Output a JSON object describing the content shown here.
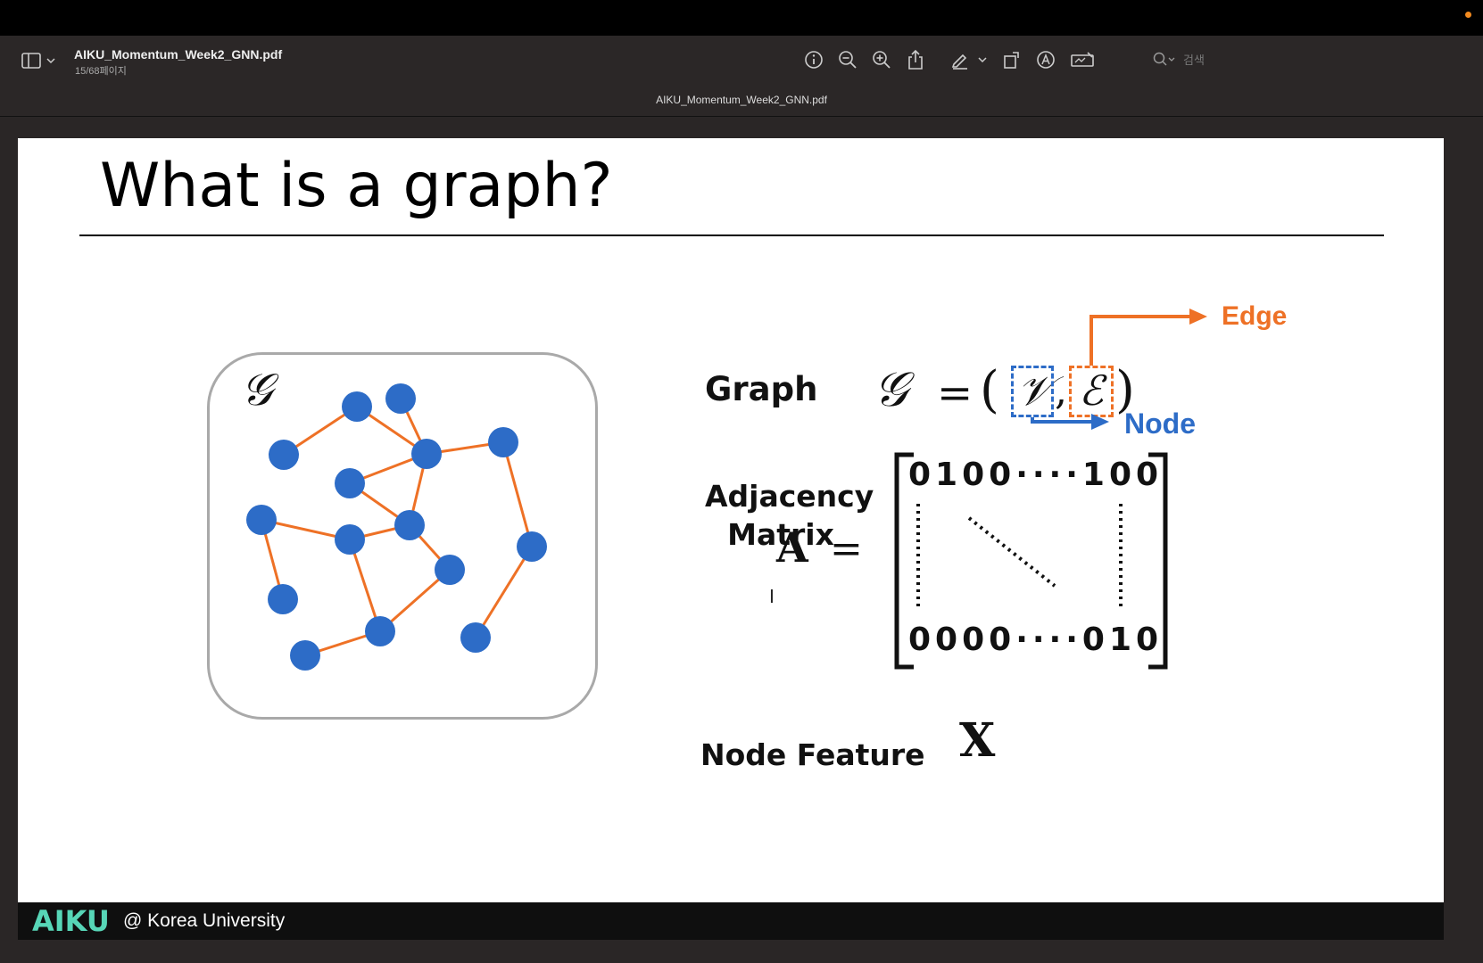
{
  "toolbar": {
    "doc_title": "AIKU_Momentum_Week2_GNN.pdf",
    "page_info": "15/68페이지",
    "tab_title": "AIKU_Momentum_Week2_GNN.pdf",
    "search_placeholder": "검색",
    "icons": [
      "info-icon",
      "zoom-out-icon",
      "zoom-in-icon",
      "share-icon",
      "highlight-icon",
      "chevron-down-icon",
      "rotate-icon",
      "markup-icon",
      "sign-icon"
    ]
  },
  "slide": {
    "title": "What is a graph?",
    "graph_symbol": "𝒢",
    "graph_label": "Graph",
    "eq_G": "𝒢",
    "eq_equals": "=",
    "eq_paren_left": "(",
    "eq_V": "𝒱",
    "eq_comma": ",",
    "eq_E": "ℰ",
    "eq_paren_right": ")",
    "edge_label": "Edge",
    "node_label": "Node",
    "adjacency_line1": "Adjacency",
    "adjacency_line2": "Matrix",
    "A_symbol": "A",
    "A_equals": "=",
    "matrix_row_first": "0100····100",
    "matrix_row_last": "0000····010",
    "node_feature_label": "Node Feature",
    "X_symbol": "X",
    "colors": {
      "node": "#2d6cc7",
      "edge": "#ee7126",
      "accent_logo": "#57d6b7"
    }
  },
  "footer": {
    "logo": "AIKU",
    "text": "@ Korea University"
  }
}
